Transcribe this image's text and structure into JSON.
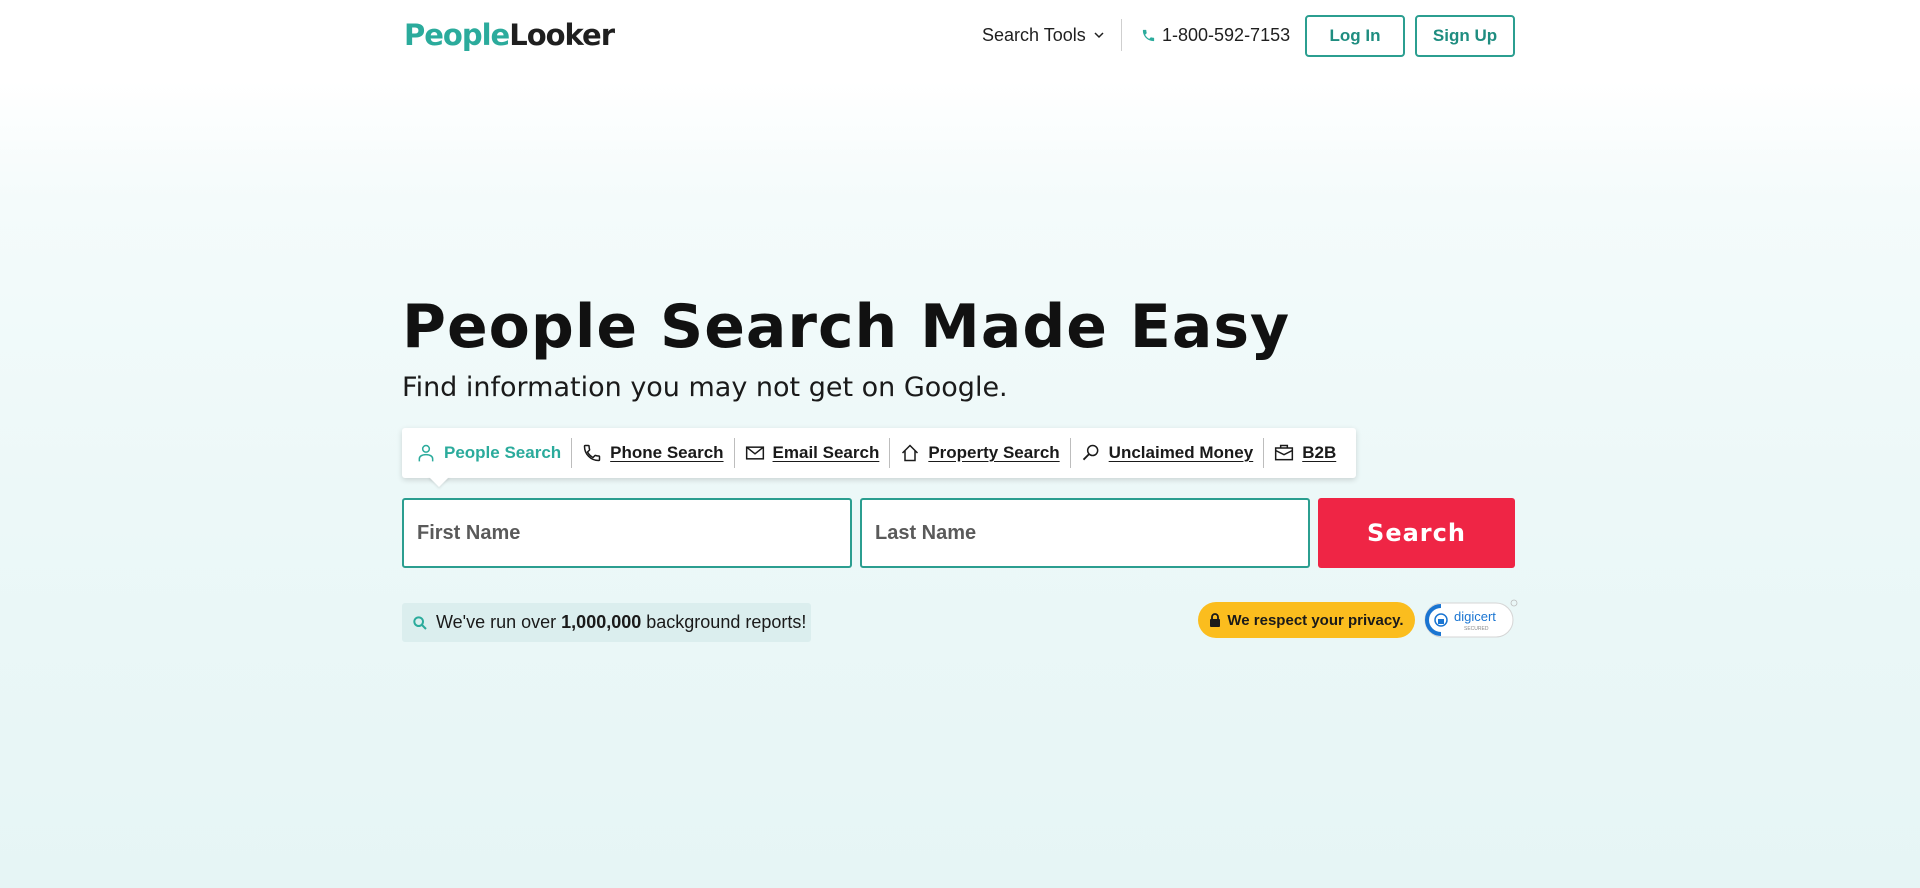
{
  "header": {
    "logo_part1": "People",
    "logo_part2": "Looker",
    "search_tools_label": "Search Tools",
    "phone_number": "1-800-592-7153",
    "login_label": "Log In",
    "signup_label": "Sign Up"
  },
  "hero": {
    "title": "People Search Made Easy",
    "subtitle": "Find information you may not get on Google."
  },
  "tabs": [
    {
      "label": "People Search",
      "icon": "person-icon",
      "active": true
    },
    {
      "label": "Phone Search",
      "icon": "phone-icon",
      "active": false
    },
    {
      "label": "Email Search",
      "icon": "envelope-icon",
      "active": false
    },
    {
      "label": "Property Search",
      "icon": "house-icon",
      "active": false
    },
    {
      "label": "Unclaimed Money",
      "icon": "magnifier-icon",
      "active": false
    },
    {
      "label": "B2B",
      "icon": "briefcase-icon",
      "active": false
    }
  ],
  "form": {
    "first_name_placeholder": "First Name",
    "last_name_placeholder": "Last Name",
    "search_label": "Search"
  },
  "reports": {
    "prefix": "We've run over",
    "count": "1,000,000",
    "suffix": "background reports!"
  },
  "privacy_label": "We respect your privacy.",
  "digicert": {
    "brand": "digicert",
    "sub": "SECURED"
  },
  "colors": {
    "brand_teal": "#2bab9c",
    "search_red": "#ef2545",
    "privacy_yellow": "#fbbd1e"
  }
}
